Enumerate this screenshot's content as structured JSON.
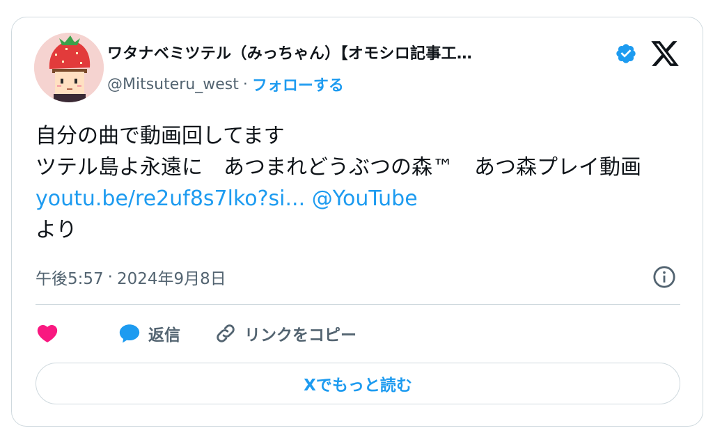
{
  "header": {
    "display_name": "ワタナベミツテル（みっちゃん）【オモシロ記事工…",
    "handle": "@Mitsuteru_west",
    "separator": "·",
    "follow_label": "フォローする"
  },
  "tweet": {
    "text_line1": "自分の曲で動画回してます",
    "text_line2": "ツテル島よ永遠に　あつまれどうぶつの森™　あつ森プレイ動画 ",
    "link_text": "youtu.be/re2uf8s7lko?si...",
    "space": " ",
    "mention": "@YouTube",
    "text_end": "より"
  },
  "meta": {
    "time": "午後5:57",
    "separator": "·",
    "date": "2024年9月8日"
  },
  "actions": {
    "reply_label": "返信",
    "copy_link_label": "リンクをコピー"
  },
  "read_more_label": "Xでもっと読む",
  "colors": {
    "accent": "#1d9bf0",
    "like": "#f91880",
    "muted": "#536471",
    "border": "#cfd9de"
  },
  "icons": [
    "avatar-strawberry-hat",
    "verified-badge-icon",
    "x-logo-icon",
    "info-icon",
    "heart-icon",
    "reply-bubble-icon",
    "link-icon"
  ]
}
